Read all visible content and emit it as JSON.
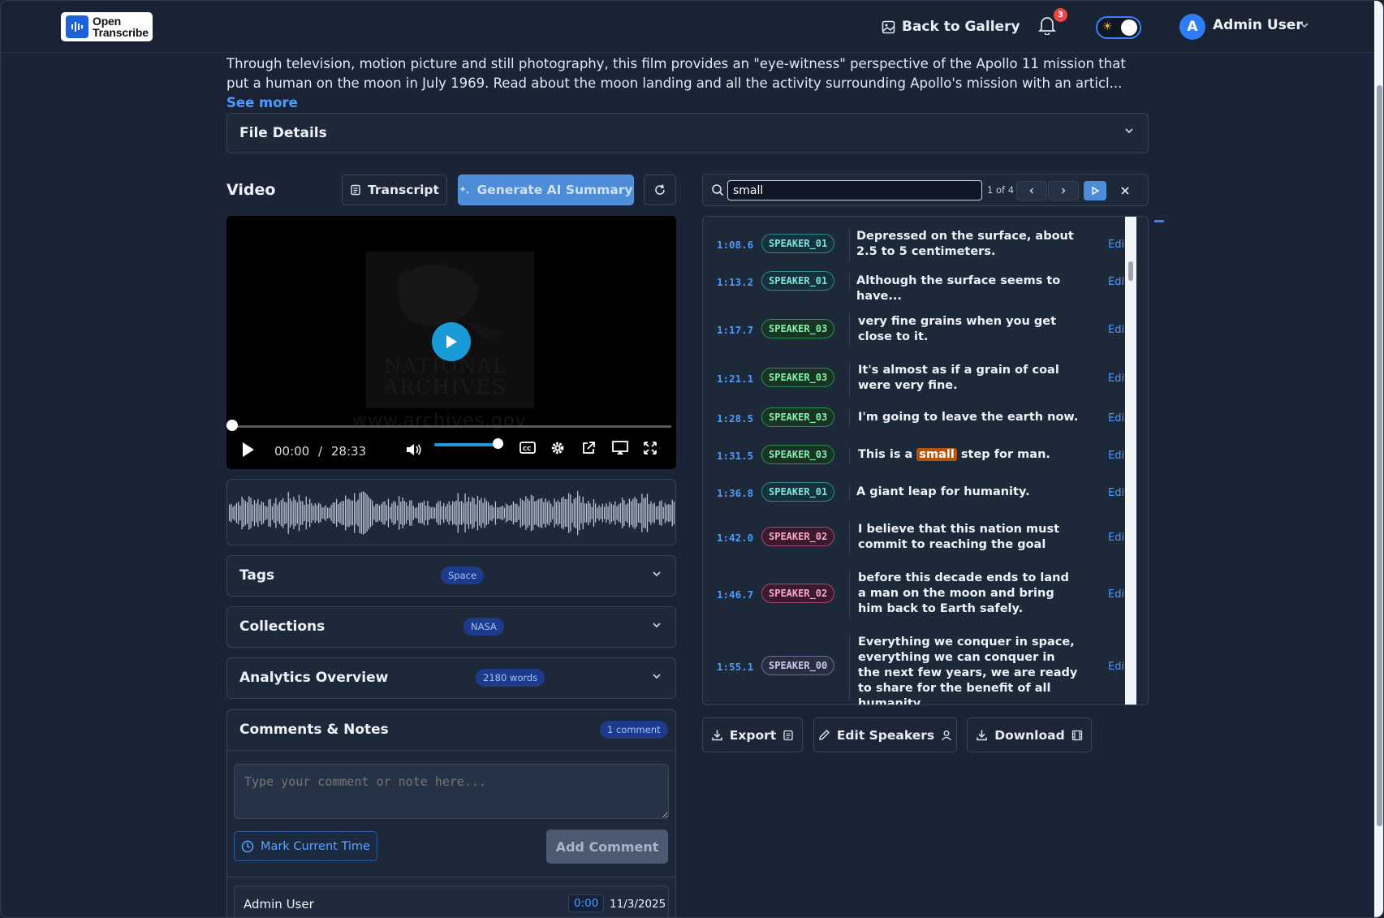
{
  "app": {
    "logo_line1": "Open",
    "logo_line2": "Transcribe"
  },
  "header": {
    "back_label": "Back to Gallery",
    "notifications_count": "3",
    "user_initial": "A",
    "user_name": "Admin User"
  },
  "description": {
    "text": "Through television, motion picture and still photography, this film provides an \"eye-witness\" perspective of the Apollo 11 mission that put a human on the moon in July 1969. Read about the moon landing and all the activity surrounding Apollo's mission with an articl...",
    "see_more": "See more"
  },
  "file_details": {
    "title": "File Details"
  },
  "video_section": {
    "title": "Video",
    "transcript_btn": "Transcript",
    "summary_btn": "Generate AI Summary",
    "current_time": "00:00",
    "separator": "/",
    "duration": "28:33",
    "poster_text_1": "NATIONAL",
    "poster_text_2": "ARCHIVES",
    "poster_url": "www.archives.gov",
    "volume_level": 0.95
  },
  "tags": {
    "title": "Tags",
    "badge": "Space"
  },
  "collections": {
    "title": "Collections",
    "badge": "NASA"
  },
  "analytics": {
    "title": "Analytics Overview",
    "badge": "2180 words"
  },
  "comments": {
    "title": "Comments & Notes",
    "count_badge": "1 comment",
    "placeholder": "Type your comment or note here...",
    "mark_time_btn": "Mark Current Time",
    "add_btn": "Add Comment",
    "entries": [
      {
        "author": "Admin User",
        "time": "0:00",
        "date": "11/3/2025"
      }
    ]
  },
  "search": {
    "query": "small",
    "match_count": "1 of 4"
  },
  "transcript": {
    "edit_label": "Edit",
    "rows": [
      {
        "time": "1:08.6",
        "speaker": "SPEAKER_01",
        "text": "Depressed on the surface, about 2.5 to 5 centimeters."
      },
      {
        "time": "1:13.2",
        "speaker": "SPEAKER_01",
        "text": "Although the surface seems to have..."
      },
      {
        "time": "1:17.7",
        "speaker": "SPEAKER_03",
        "text": "very fine grains when you get close to it."
      },
      {
        "time": "1:21.1",
        "speaker": "SPEAKER_03",
        "text": "It's almost as if a grain of coal were very fine."
      },
      {
        "time": "1:28.5",
        "speaker": "SPEAKER_03",
        "text": "I'm going to leave the earth now."
      },
      {
        "time": "1:31.5",
        "speaker": "SPEAKER_03",
        "text_pre": "This is a",
        "text_hl": "small",
        "text_post": "step for man."
      },
      {
        "time": "1:36.8",
        "speaker": "SPEAKER_01",
        "text": "A giant leap for humanity."
      },
      {
        "time": "1:42.0",
        "speaker": "SPEAKER_02",
        "text": "I believe that this nation must commit to reaching the goal"
      },
      {
        "time": "1:46.7",
        "speaker": "SPEAKER_02",
        "text": "before this decade ends to land a man on the moon and bring him back to Earth safely."
      },
      {
        "time": "1:55.1",
        "speaker": "SPEAKER_00",
        "text": "Everything we conquer in space, everything we can conquer in the next few years, we are ready to share for the benefit of all humanity."
      }
    ]
  },
  "actions": {
    "export": "Export",
    "edit_speakers": "Edit Speakers",
    "download": "Download"
  },
  "colors": {
    "accent": "#4c9bff",
    "highlight": "#b45309",
    "background": "#1a2436"
  }
}
